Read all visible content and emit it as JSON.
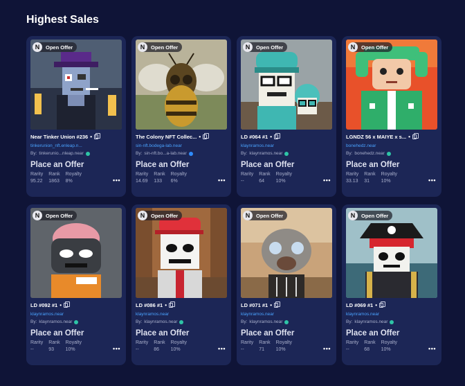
{
  "section": {
    "title": "Highest Sales"
  },
  "colors": {
    "background": "#0f1437",
    "card": "#1c2656",
    "link": "#4aa3ff",
    "verified": "#2ec4a6"
  },
  "cards": [
    {
      "chip": "Open Offer",
      "logo": "N",
      "title": "Near Tinker Union #236",
      "contract": "tinkerunion_nft.enleap.n...",
      "by_prefix": "By:",
      "by": "tinkerunio...nleap.near",
      "offer": "Place an Offer",
      "rarity_label": "Rarity",
      "rarity": "95.22",
      "rank_label": "Rank",
      "rank": "1863",
      "royalty_label": "Royalty",
      "royalty": "8%",
      "more": "•••"
    },
    {
      "chip": "Open Offer",
      "logo": "N",
      "title": "The Colony NFT Collec...",
      "contract": "sin-nft.bodega-lab.near",
      "by_prefix": "By:",
      "by": "sin-nft.bo...a-lab.near",
      "offer": "Place an Offer",
      "rarity_label": "Rarity",
      "rarity": "14.69",
      "rank_label": "Rank",
      "rank": "133",
      "royalty_label": "Royalty",
      "royalty": "6%",
      "more": "•••"
    },
    {
      "chip": "Open Offer",
      "logo": "N",
      "title": "LD #064 #1",
      "contract": "klaynramos.near",
      "by_prefix": "By:",
      "by": "klaynramos.near",
      "offer": "Place an Offer",
      "rarity_label": "Rarity",
      "rarity": "--",
      "rank_label": "Rank",
      "rank": "64",
      "royalty_label": "Royalty",
      "royalty": "10%",
      "more": "•••"
    },
    {
      "chip": "Open Offer",
      "logo": "N",
      "title": "LGNDZ 56 x MAIYE x s...",
      "contract": "bonehedz.near",
      "by_prefix": "By:",
      "by": "bonehedz.near",
      "offer": "Place an Offer",
      "rarity_label": "Rarity",
      "rarity": "33.13",
      "rank_label": "Rank",
      "rank": "31",
      "royalty_label": "Royalty",
      "royalty": "10%",
      "more": "•••"
    },
    {
      "chip": "Open Offer",
      "logo": "N",
      "title": "LD #092 #1",
      "contract": "klaynramos.near",
      "by_prefix": "By:",
      "by": "klaynramos.near",
      "offer": "Place an Offer",
      "rarity_label": "Rarity",
      "rarity": "--",
      "rank_label": "Rank",
      "rank": "93",
      "royalty_label": "Royalty",
      "royalty": "10%",
      "more": "•••"
    },
    {
      "chip": "Open Offer",
      "logo": "N",
      "title": "LD #086 #1",
      "contract": "klaynramos.near",
      "by_prefix": "By:",
      "by": "klaynramos.near",
      "offer": "Place an Offer",
      "rarity_label": "Rarity",
      "rarity": "--",
      "rank_label": "Rank",
      "rank": "86",
      "royalty_label": "Royalty",
      "royalty": "10%",
      "more": "•••"
    },
    {
      "chip": "Open Offer",
      "logo": "N",
      "title": "LD #071 #1",
      "contract": "klaynramos.near",
      "by_prefix": "By:",
      "by": "klaynramos.near",
      "offer": "Place an Offer",
      "rarity_label": "Rarity",
      "rarity": "--",
      "rank_label": "Rank",
      "rank": "71",
      "royalty_label": "Royalty",
      "royalty": "10%",
      "more": "•••"
    },
    {
      "chip": "Open Offer",
      "logo": "N",
      "title": "LD #069 #1",
      "contract": "klaynramos.near",
      "by_prefix": "By:",
      "by": "klaynramos.near",
      "offer": "Place an Offer",
      "rarity_label": "Rarity",
      "rarity": "--",
      "rank_label": "Rank",
      "rank": "68",
      "royalty_label": "Royalty",
      "royalty": "10%",
      "more": "•••"
    }
  ]
}
